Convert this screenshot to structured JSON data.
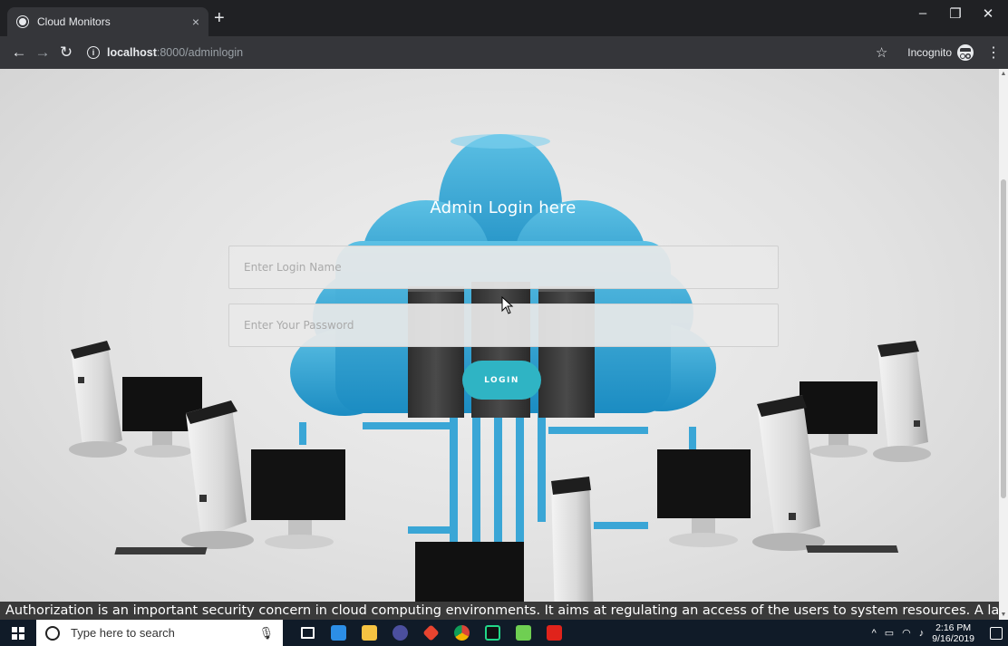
{
  "browser": {
    "tab_title": "Cloud Monitors",
    "tab_close": "×",
    "new_tab": "+",
    "url_host": "localhost",
    "url_path": ":8000/adminlogin",
    "incognito_label": "Incognito",
    "window_controls": [
      "–",
      "❐",
      "✕"
    ]
  },
  "login": {
    "title": "Admin Login here",
    "login_name_placeholder": "Enter Login Name",
    "password_placeholder": "Enter Your Password",
    "button_label": "LOGIN"
  },
  "footer": {
    "marquee_text": "Authorization is an important security concern in cloud computing environments. It aims at regulating an access of the users to system resources. A large number of"
  },
  "taskbar": {
    "search_placeholder": "Type here to search",
    "apps": [
      {
        "name": "task-view",
        "color": "#ffffff"
      },
      {
        "name": "vscode",
        "color": "#2c8ee6"
      },
      {
        "name": "file-explorer",
        "color": "#f5c342"
      },
      {
        "name": "eclipse",
        "color": "#4b4f9e"
      },
      {
        "name": "git",
        "color": "#e8442f"
      },
      {
        "name": "chrome",
        "color": "#e8b518"
      },
      {
        "name": "pycharm",
        "color": "#21d789"
      },
      {
        "name": "notepad",
        "color": "#6fcf52"
      },
      {
        "name": "acrobat",
        "color": "#e0231b"
      }
    ],
    "time": "2:16 PM",
    "date": "9/16/2019"
  },
  "colors": {
    "accent": "#2fb4c4",
    "cloud": "#2a9fd0",
    "server": "#3d3d3d"
  }
}
